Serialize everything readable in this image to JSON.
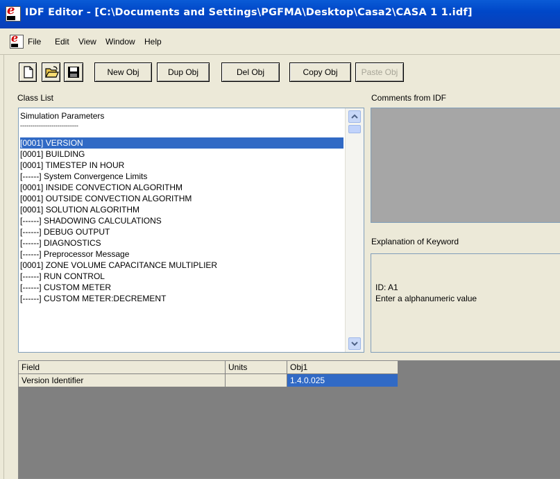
{
  "window": {
    "title": "IDF Editor - [C:\\Documents and Settings\\PGFMA\\Desktop\\Casa2\\CASA 1 1.idf]"
  },
  "menu": [
    "File",
    "Edit",
    "View",
    "Window",
    "Help"
  ],
  "toolbar": {
    "icons": [
      "new-file-icon",
      "open-folder-icon",
      "save-disk-icon"
    ],
    "buttons": [
      {
        "label": "New Obj",
        "enabled": true
      },
      {
        "label": "Dup Obj",
        "enabled": true
      },
      {
        "label": "Del Obj",
        "enabled": true
      },
      {
        "label": "Copy Obj",
        "enabled": true
      },
      {
        "label": "Paste Obj",
        "enabled": false
      }
    ]
  },
  "class_list": {
    "label": "Class List",
    "items": [
      "Simulation Parameters",
      "----------------------------",
      "[0001]  VERSION",
      "[0001]  BUILDING",
      "[0001]  TIMESTEP IN HOUR",
      "[------]  System Convergence Limits",
      "[0001]  INSIDE CONVECTION ALGORITHM",
      "[0001]  OUTSIDE CONVECTION ALGORITHM",
      "[0001]  SOLUTION ALGORITHM",
      "[------]  SHADOWING CALCULATIONS",
      "[------]  DEBUG OUTPUT",
      "[------]  DIAGNOSTICS",
      "[------]  Preprocessor Message",
      "[0001]  ZONE VOLUME CAPACITANCE MULTIPLIER",
      "[------]  RUN CONTROL",
      "[------]  CUSTOM METER",
      "[------]  CUSTOM METER:DECREMENT"
    ],
    "selected_index": 2
  },
  "comments": {
    "label": "Comments from IDF"
  },
  "explanation": {
    "label": "Explanation of Keyword",
    "lines": [
      "ID: A1",
      "Enter a alphanumeric value"
    ]
  },
  "grid": {
    "headers": [
      "Field",
      "Units",
      "Obj1"
    ],
    "rows": [
      {
        "field": "Version Identifier",
        "units": "",
        "obj1": "1.4.0.025"
      }
    ]
  },
  "colors": {
    "selection": "#316ac5",
    "titlebar": "#0047c8",
    "background": "#ece9d8",
    "grid_background": "#808080"
  }
}
